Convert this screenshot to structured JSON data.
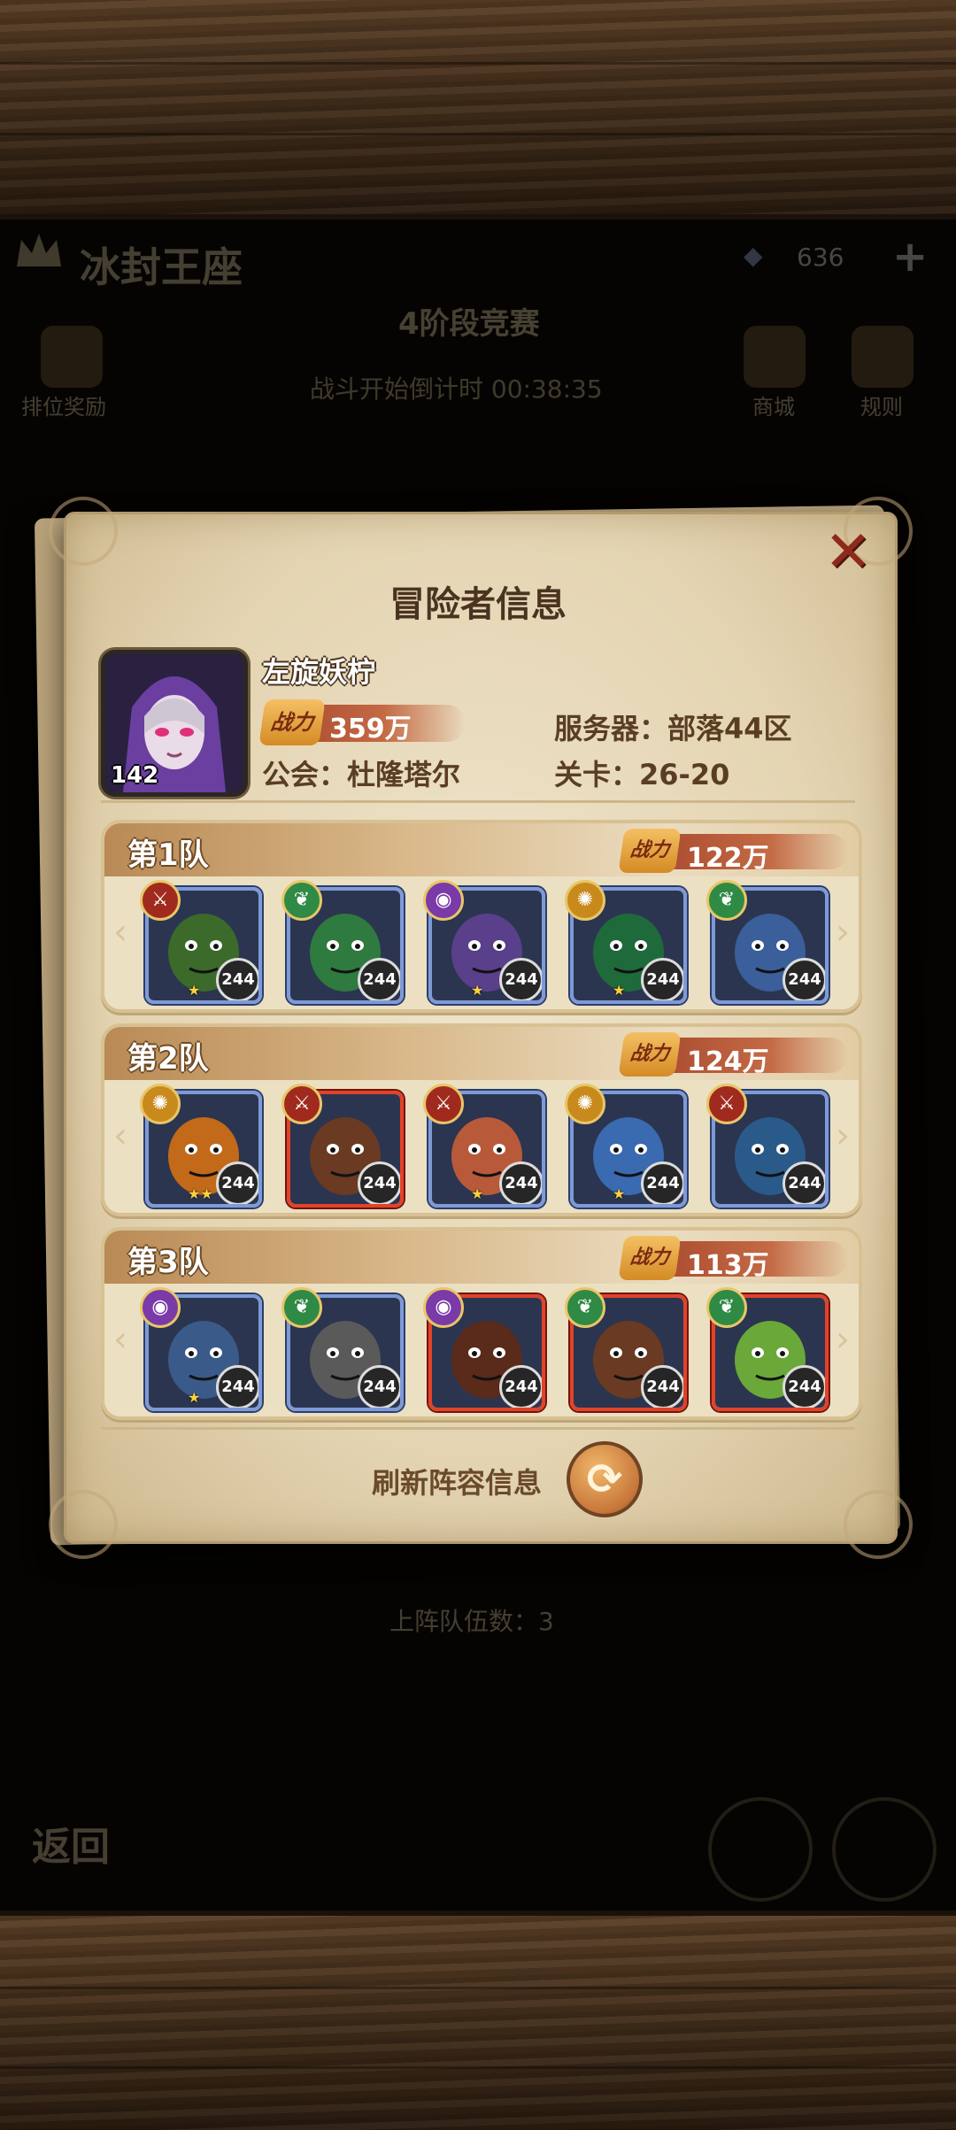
{
  "panel": {
    "title": "冒险者信息",
    "close": "✕"
  },
  "player": {
    "name": "左旋妖柠",
    "level": "142",
    "power_tag": "战力",
    "power": "359万",
    "server": "服务器：部落44区",
    "guild": "公会：杜隆塔尔",
    "stage": "关卡：26-20"
  },
  "teams": [
    {
      "label": "第1队",
      "power_tag": "战力",
      "power": "122万",
      "heroes": [
        {
          "level": "244",
          "faction": "horde",
          "faction_icon": "horde-crest-icon",
          "stars": "★"
        },
        {
          "level": "244",
          "faction": "nature",
          "faction_icon": "leaf-crest-icon",
          "stars": ""
        },
        {
          "level": "244",
          "faction": "arcane",
          "faction_icon": "eye-crest-icon",
          "stars": "★"
        },
        {
          "level": "244",
          "faction": "holy",
          "faction_icon": "sun-crest-icon",
          "stars": "★"
        },
        {
          "level": "244",
          "faction": "nature",
          "faction_icon": "leaf-crest-icon",
          "stars": ""
        }
      ]
    },
    {
      "label": "第2队",
      "power_tag": "战力",
      "power": "124万",
      "heroes": [
        {
          "level": "244",
          "faction": "holy",
          "faction_icon": "sun-crest-icon",
          "stars": "★★"
        },
        {
          "level": "244",
          "faction": "horde",
          "faction_icon": "horde-crest-icon",
          "stars": ""
        },
        {
          "level": "244",
          "faction": "horde",
          "faction_icon": "horde-crest-icon",
          "stars": "★"
        },
        {
          "level": "244",
          "faction": "holy",
          "faction_icon": "sun-crest-icon",
          "stars": "★"
        },
        {
          "level": "244",
          "faction": "horde",
          "faction_icon": "horde-crest-icon",
          "stars": ""
        }
      ]
    },
    {
      "label": "第3队",
      "power_tag": "战力",
      "power": "113万",
      "heroes": [
        {
          "level": "244",
          "faction": "arcane",
          "faction_icon": "eye-crest-icon",
          "stars": "★"
        },
        {
          "level": "244",
          "faction": "nature",
          "faction_icon": "leaf-crest-icon",
          "stars": ""
        },
        {
          "level": "244",
          "faction": "arcane",
          "faction_icon": "eye-crest-icon",
          "stars": ""
        },
        {
          "level": "244",
          "faction": "nature",
          "faction_icon": "leaf-crest-icon",
          "stars": ""
        },
        {
          "level": "244",
          "faction": "nature",
          "faction_icon": "leaf-crest-icon",
          "stars": ""
        }
      ]
    }
  ],
  "refresh": {
    "label": "刷新阵容信息",
    "icon": "refresh-icon",
    "glyph": "⟳"
  },
  "background": {
    "title": "冰封王座",
    "gems": "636",
    "subtitle": "4阶段竞赛",
    "timer": "战斗开始倒计时 00:38:35",
    "rank_reward": "排位奖励",
    "shop": "商城",
    "rules": "规则",
    "back": "返回",
    "team_count": "上阵队伍数：3"
  },
  "colors": {
    "panel": "#e8dbbd",
    "accent_red": "#a2432a",
    "title_brown": "#4a3421"
  }
}
